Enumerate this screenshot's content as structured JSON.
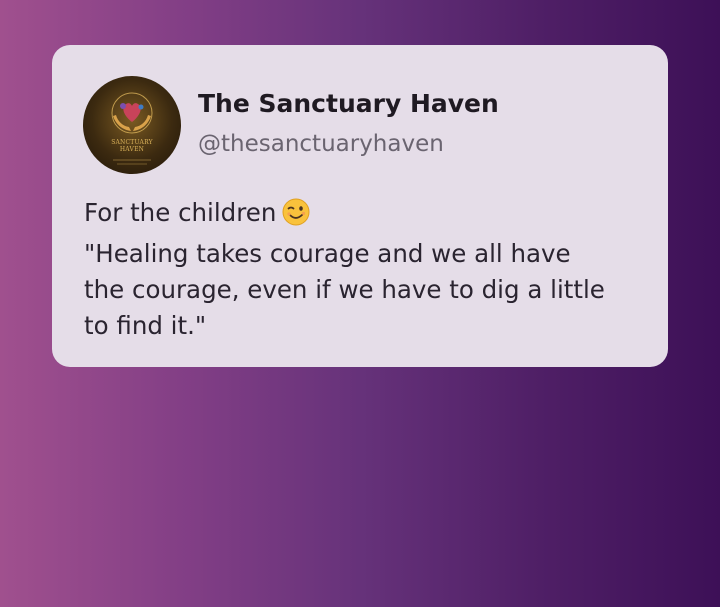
{
  "post": {
    "author_name": "The Sanctuary Haven",
    "author_handle": "@thesanctuaryhaven",
    "avatar_logo_text_line1": "SANCTUARY",
    "avatar_logo_text_line2": "HAVEN",
    "lines": [
      "For the children",
      "\"Healing takes courage and we all have",
      "the courage, even if we have to dig a little",
      "to find it.\""
    ],
    "emoji": "winking-face-emoji"
  },
  "colors": {
    "background_start": "#a0508e",
    "background_end": "#3d1057",
    "card": "#e5dde8",
    "name_text": "#1f1a22",
    "handle_text": "#6a6470",
    "body_text": "#2a2430",
    "logo_gold": "#d9b15a"
  }
}
